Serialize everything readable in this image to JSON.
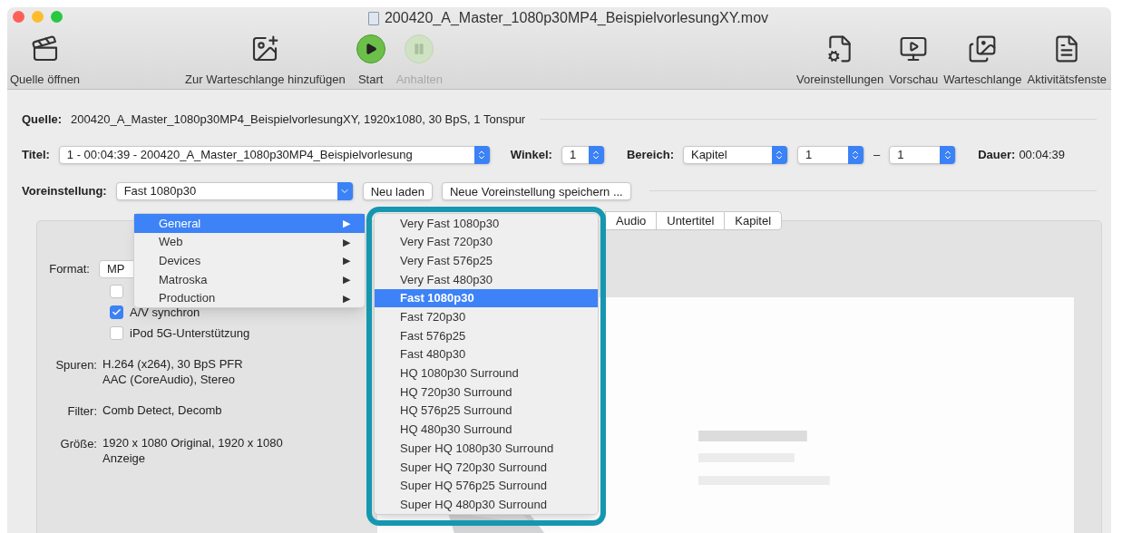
{
  "window": {
    "title": "200420_A_Master_1080p30MP4_BeispielvorlesungXY.mov"
  },
  "toolbar": [
    {
      "kind": "open",
      "label": "Quelle öffnen",
      "disabled": false
    },
    {
      "kind": "add_queue",
      "label": "Zur Warteschlange hinzufügen",
      "disabled": false
    },
    {
      "kind": "start",
      "label": "Start",
      "disabled": false
    },
    {
      "kind": "pause",
      "label": "Anhalten",
      "disabled": true
    },
    {
      "kind": "presets",
      "label": "Voreinstellungen",
      "disabled": false
    },
    {
      "kind": "preview",
      "label": "Vorschau",
      "disabled": false
    },
    {
      "kind": "queue",
      "label": "Warteschlange",
      "disabled": false
    },
    {
      "kind": "activity",
      "label": "Aktivitätsfenste",
      "disabled": false
    }
  ],
  "source": {
    "label": "Quelle:",
    "value": "200420_A_Master_1080p30MP4_BeispielvorlesungXY, 1920x1080, 30 BpS, 1 Tonspur"
  },
  "title_row": {
    "label": "Titel:",
    "value": "1 - 00:04:39 - 200420_A_Master_1080p30MP4_Beispielvorlesung",
    "angle_label": "Winkel:",
    "angle": "1",
    "range_label": "Bereich:",
    "range_mode": "Kapitel",
    "range_from": "1",
    "range_sep": "–",
    "range_to": "1",
    "duration_label": "Dauer:",
    "duration": "00:04:39"
  },
  "preset_row": {
    "label": "Voreinstellung:",
    "value": "Fast 1080p30",
    "buttons": [
      "Neu laden",
      "Neue Voreinstellung speichern ..."
    ]
  },
  "preset_menu": {
    "categories": [
      {
        "label": "General",
        "selected": true
      },
      {
        "label": "Web",
        "selected": false
      },
      {
        "label": "Devices",
        "selected": false
      },
      {
        "label": "Matroska",
        "selected": false
      },
      {
        "label": "Production",
        "selected": false
      }
    ],
    "submenu_arrow": "▶",
    "presets": [
      {
        "label": "Very Fast 1080p30",
        "selected": false
      },
      {
        "label": "Very Fast 720p30",
        "selected": false
      },
      {
        "label": "Very Fast 576p25",
        "selected": false
      },
      {
        "label": "Very Fast 480p30",
        "selected": false
      },
      {
        "label": "Fast 1080p30",
        "selected": true
      },
      {
        "label": "Fast 720p30",
        "selected": false
      },
      {
        "label": "Fast 576p25",
        "selected": false
      },
      {
        "label": "Fast 480p30",
        "selected": false
      },
      {
        "label": "HQ 1080p30 Surround",
        "selected": false
      },
      {
        "label": "HQ 720p30 Surround",
        "selected": false
      },
      {
        "label": "HQ 576p25 Surround",
        "selected": false
      },
      {
        "label": "HQ 480p30 Surround",
        "selected": false
      },
      {
        "label": "Super HQ 1080p30 Surround",
        "selected": false
      },
      {
        "label": "Super HQ 720p30 Surround",
        "selected": false
      },
      {
        "label": "Super HQ 576p25 Surround",
        "selected": false
      },
      {
        "label": "Super HQ 480p30 Surround",
        "selected": false
      }
    ]
  },
  "tabs": [
    {
      "label": "Audio",
      "selected": false
    },
    {
      "label": "Untertitel",
      "selected": false
    },
    {
      "label": "Kapitel",
      "selected": false
    }
  ],
  "summary": {
    "format_label": "Format:",
    "format_value": "MP",
    "checkboxes": [
      {
        "checked": false
      },
      {
        "label": "A/V synchron",
        "checked": true
      },
      {
        "label": "iPod 5G-Unterstützung",
        "checked": false
      }
    ],
    "rows": [
      {
        "label": "Spuren:",
        "lines": [
          "H.264 (x264), 30 BpS PFR",
          "AAC (CoreAudio), Stereo"
        ]
      },
      {
        "label": "Filter:",
        "lines": [
          "Comb Detect, Decomb"
        ]
      },
      {
        "label": "Größe:",
        "lines": [
          "1920 x 1080 Original, 1920 x 1080 Anzeige"
        ]
      }
    ]
  }
}
